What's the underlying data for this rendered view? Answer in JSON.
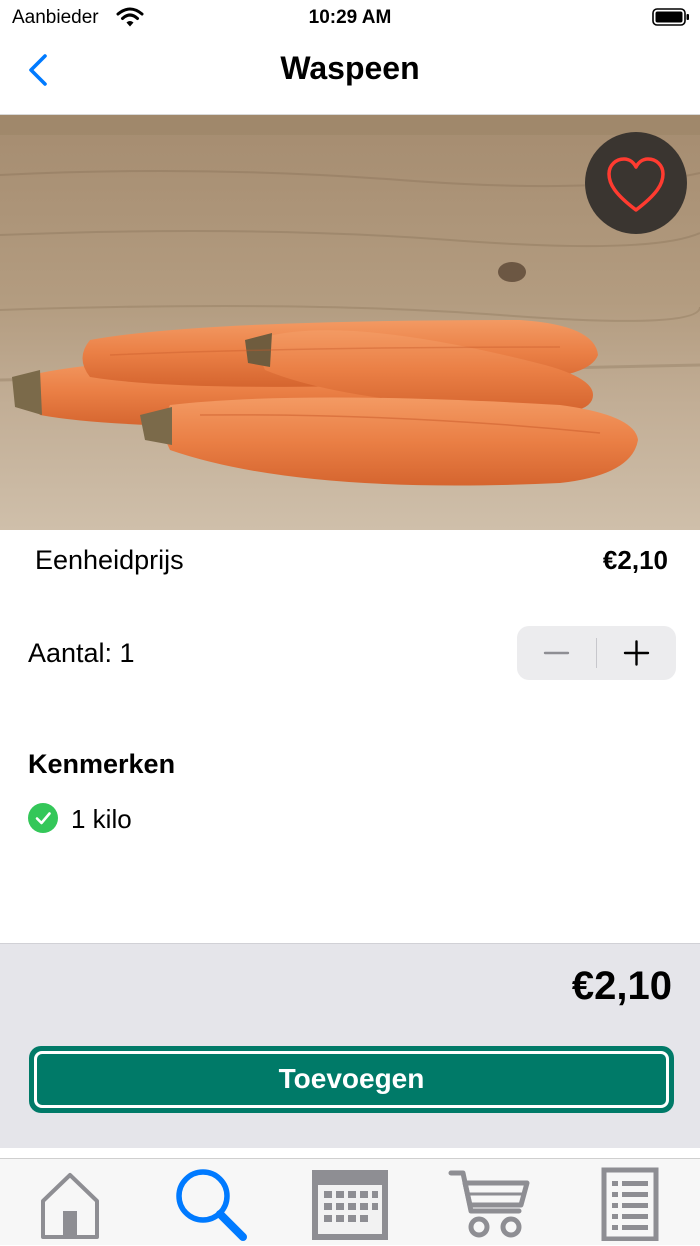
{
  "status_bar": {
    "carrier": "Aanbieder",
    "time": "10:29 AM"
  },
  "nav": {
    "title": "Waspeen",
    "back_icon": "chevron-left-icon"
  },
  "product": {
    "image_alt": "Waspeen (carrots)",
    "favorite_icon": "heart-icon",
    "unit_price_label": "Eenheidprijs",
    "unit_price": "€2,10",
    "quantity_label": "Aantal: 1",
    "features_title": "Kenmerken",
    "features": [
      {
        "text": "1 kilo",
        "icon": "checkmark-circle-icon"
      }
    ]
  },
  "checkout": {
    "total": "€2,10",
    "add_button": "Toevoegen"
  },
  "tabs": [
    {
      "name": "home",
      "icon": "home-icon",
      "active": false
    },
    {
      "name": "search",
      "icon": "search-icon",
      "active": true
    },
    {
      "name": "calendar",
      "icon": "calendar-icon",
      "active": false
    },
    {
      "name": "cart",
      "icon": "cart-icon",
      "active": false
    },
    {
      "name": "list",
      "icon": "list-icon",
      "active": false
    }
  ],
  "colors": {
    "accent_blue": "#007aff",
    "brand_green": "#007a68",
    "check_green": "#34c759",
    "heart_red": "#ff3b30",
    "tab_inactive": "#8e8e93"
  }
}
